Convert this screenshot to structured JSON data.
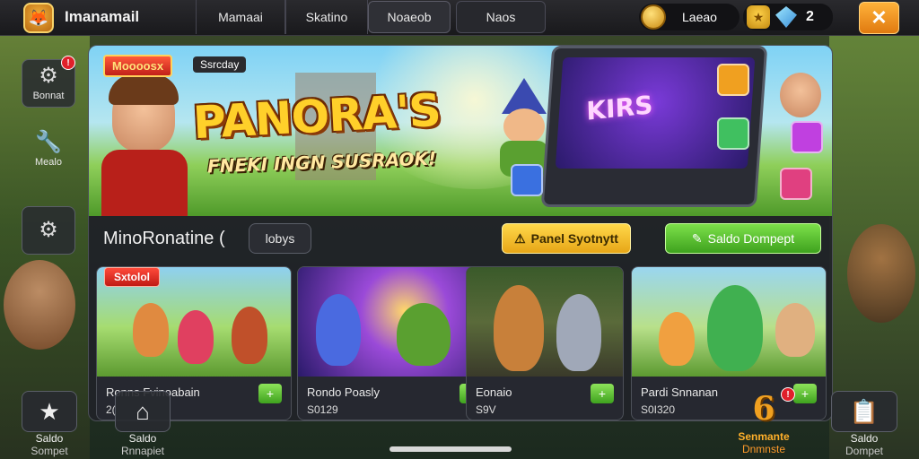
{
  "app": {
    "title": "Imanamail",
    "logo_icon": "shield-logo-icon"
  },
  "tabs": [
    {
      "label": "Mamaai"
    },
    {
      "label": "Skatino"
    },
    {
      "label": "Noaeob"
    },
    {
      "label": "Naos"
    }
  ],
  "currency": {
    "coins": "Laeao",
    "gems": "2"
  },
  "sidebar": {
    "items": [
      {
        "label": "Bonnat",
        "icon": "gear-icon",
        "badge": "!"
      },
      {
        "label": "Mealo",
        "icon": "wrench-icon"
      },
      {
        "label": "",
        "icon": "settings-icon"
      }
    ]
  },
  "banner": {
    "tag_primary": "Moooosx",
    "tag_secondary": "Ssrcday",
    "title": "PANORA'S",
    "subtitle": "FNEKI INGN SUSRAOK!",
    "screen_text": "KIRS"
  },
  "section": {
    "title": "MinoRonatine (",
    "chip": "lobys",
    "yellow_button": "Panel Syotnytt",
    "green_button": "Saldo Dompept"
  },
  "cards": [
    {
      "tag": "Sxtolol",
      "title": "Ronns Fvinoabain",
      "price": "2("
    },
    {
      "title": "Rondo Poasly",
      "price": "S0129"
    },
    {
      "title": "Eonaio",
      "price": "S9V"
    },
    {
      "title": "Pardi Snnanan",
      "price": "S0I320"
    }
  ],
  "bottom_bar": [
    {
      "label": "Saldo",
      "sub": "Sompet",
      "icon": "star-icon"
    },
    {
      "label": "Saldo",
      "sub": "Rnnapiet",
      "icon": "home-icon"
    },
    {
      "label": "Senmante",
      "sub": "Dnmnste",
      "icon": "number-six-icon",
      "badge": "!",
      "badge_value": "6"
    },
    {
      "label": "Saldo",
      "sub": "Dompet",
      "icon": "clipboard-icon"
    }
  ],
  "colors": {
    "accent_orange": "#e07a10",
    "accent_green": "#3ea21e",
    "accent_yellow": "#e7a617",
    "badge_red": "#e0202a"
  }
}
